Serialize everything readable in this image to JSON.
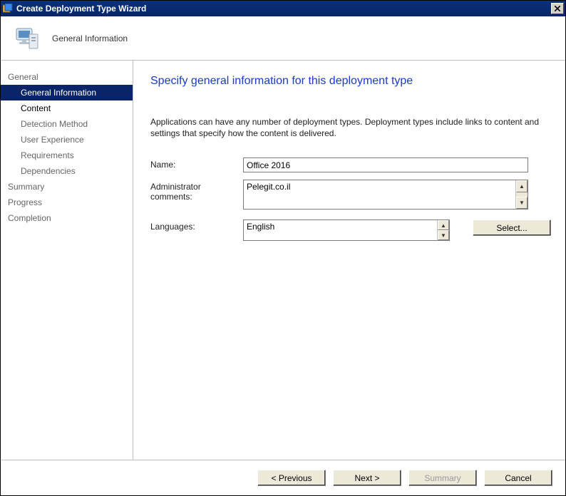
{
  "window": {
    "title": "Create Deployment Type Wizard"
  },
  "header": {
    "title": "General Information"
  },
  "sidebar": {
    "groups": [
      {
        "label": "General",
        "items": [
          {
            "label": "General Information",
            "selected": true
          },
          {
            "label": "Content",
            "dark": true
          },
          {
            "label": "Detection Method"
          },
          {
            "label": "User Experience"
          },
          {
            "label": "Requirements"
          },
          {
            "label": "Dependencies"
          }
        ]
      }
    ],
    "tail": [
      {
        "label": "Summary"
      },
      {
        "label": "Progress"
      },
      {
        "label": "Completion"
      }
    ]
  },
  "page": {
    "heading": "Specify general information for this deployment type",
    "description": "Applications can have any number of deployment types. Deployment types include links to content and settings that specify how the content is delivered.",
    "fields": {
      "name_label": "Name:",
      "name_value": "Office 2016",
      "comments_label": "Administrator comments:",
      "comments_value": "Pelegit.co.il",
      "languages_label": "Languages:",
      "languages_value": "English",
      "select_button": "Select..."
    }
  },
  "footer": {
    "previous": "< Previous",
    "next": "Next >",
    "summary": "Summary",
    "cancel": "Cancel"
  }
}
